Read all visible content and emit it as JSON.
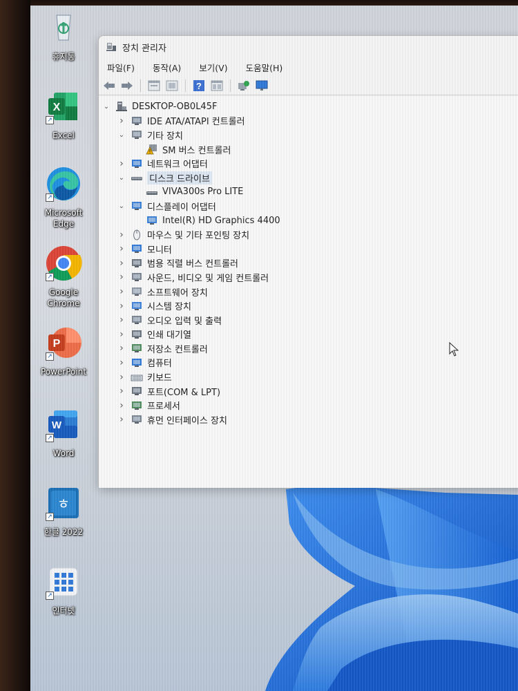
{
  "desktop": {
    "icons": [
      {
        "label": "휴지통",
        "icon": "recycle-bin-icon"
      },
      {
        "label": "Excel",
        "icon": "excel-icon"
      },
      {
        "label": "Microsoft Edge",
        "icon": "edge-icon"
      },
      {
        "label": "Google Chrome",
        "icon": "chrome-icon"
      },
      {
        "label": "PowerPoint",
        "icon": "powerpoint-icon"
      },
      {
        "label": "Word",
        "icon": "word-icon"
      },
      {
        "label": "한글 2022",
        "icon": "hangul-icon"
      },
      {
        "label": "인터넷",
        "icon": "internet-apps-icon"
      }
    ]
  },
  "window": {
    "title": "장치 관리자",
    "menu": [
      "파일(F)",
      "동작(A)",
      "보기(V)",
      "도움말(H)"
    ],
    "toolbar": [
      "back-icon",
      "forward-icon",
      "properties-icon",
      "view-icon",
      "help-icon",
      "show-hidden-icon",
      "scan-hardware-icon",
      "monitor-icon"
    ]
  },
  "tree": {
    "root": "DESKTOP-OB0L45F",
    "nodes": [
      {
        "label": "IDE ATA/ATAPI 컨트롤러",
        "level": 1,
        "state": "collapsed",
        "icon": "ide-controller-icon"
      },
      {
        "label": "기타 장치",
        "level": 1,
        "state": "expanded",
        "icon": "other-devices-icon"
      },
      {
        "label": "SM 버스 컨트롤러",
        "level": 2,
        "state": "leaf",
        "icon": "warning-device-icon"
      },
      {
        "label": "네트워크 어댑터",
        "level": 1,
        "state": "collapsed",
        "icon": "network-adapter-icon"
      },
      {
        "label": "디스크 드라이브",
        "level": 1,
        "state": "expanded",
        "icon": "disk-drive-icon",
        "selected": true
      },
      {
        "label": "VIVA300s Pro LITE",
        "level": 2,
        "state": "leaf",
        "icon": "disk-icon"
      },
      {
        "label": "디스플레이 어댑터",
        "level": 1,
        "state": "expanded",
        "icon": "display-adapter-icon"
      },
      {
        "label": "Intel(R) HD Graphics 4400",
        "level": 2,
        "state": "leaf",
        "icon": "display-icon"
      },
      {
        "label": "마우스 및 기타 포인팅 장치",
        "level": 1,
        "state": "collapsed",
        "icon": "mouse-icon"
      },
      {
        "label": "모니터",
        "level": 1,
        "state": "collapsed",
        "icon": "monitor-icon"
      },
      {
        "label": "범용 직렬 버스 컨트롤러",
        "level": 1,
        "state": "collapsed",
        "icon": "usb-icon"
      },
      {
        "label": "사운드, 비디오 및 게임 컨트롤러",
        "level": 1,
        "state": "collapsed",
        "icon": "sound-icon"
      },
      {
        "label": "소프트웨어 장치",
        "level": 1,
        "state": "collapsed",
        "icon": "software-device-icon"
      },
      {
        "label": "시스템 장치",
        "level": 1,
        "state": "collapsed",
        "icon": "system-device-icon"
      },
      {
        "label": "오디오 입력 및 출력",
        "level": 1,
        "state": "collapsed",
        "icon": "audio-io-icon"
      },
      {
        "label": "인쇄 대기열",
        "level": 1,
        "state": "collapsed",
        "icon": "print-queue-icon"
      },
      {
        "label": "저장소 컨트롤러",
        "level": 1,
        "state": "collapsed",
        "icon": "storage-controller-icon"
      },
      {
        "label": "컴퓨터",
        "level": 1,
        "state": "collapsed",
        "icon": "computer-icon"
      },
      {
        "label": "키보드",
        "level": 1,
        "state": "collapsed",
        "icon": "keyboard-icon"
      },
      {
        "label": "포트(COM & LPT)",
        "level": 1,
        "state": "collapsed",
        "icon": "port-icon"
      },
      {
        "label": "프로세서",
        "level": 1,
        "state": "collapsed",
        "icon": "processor-icon"
      },
      {
        "label": "휴먼 인터페이스 장치",
        "level": 1,
        "state": "collapsed",
        "icon": "hid-icon"
      }
    ]
  },
  "colors": {
    "window_bg": "#f7f8f7",
    "selection": "#dce6f2",
    "bloom_blue": "#1a6fd8"
  }
}
